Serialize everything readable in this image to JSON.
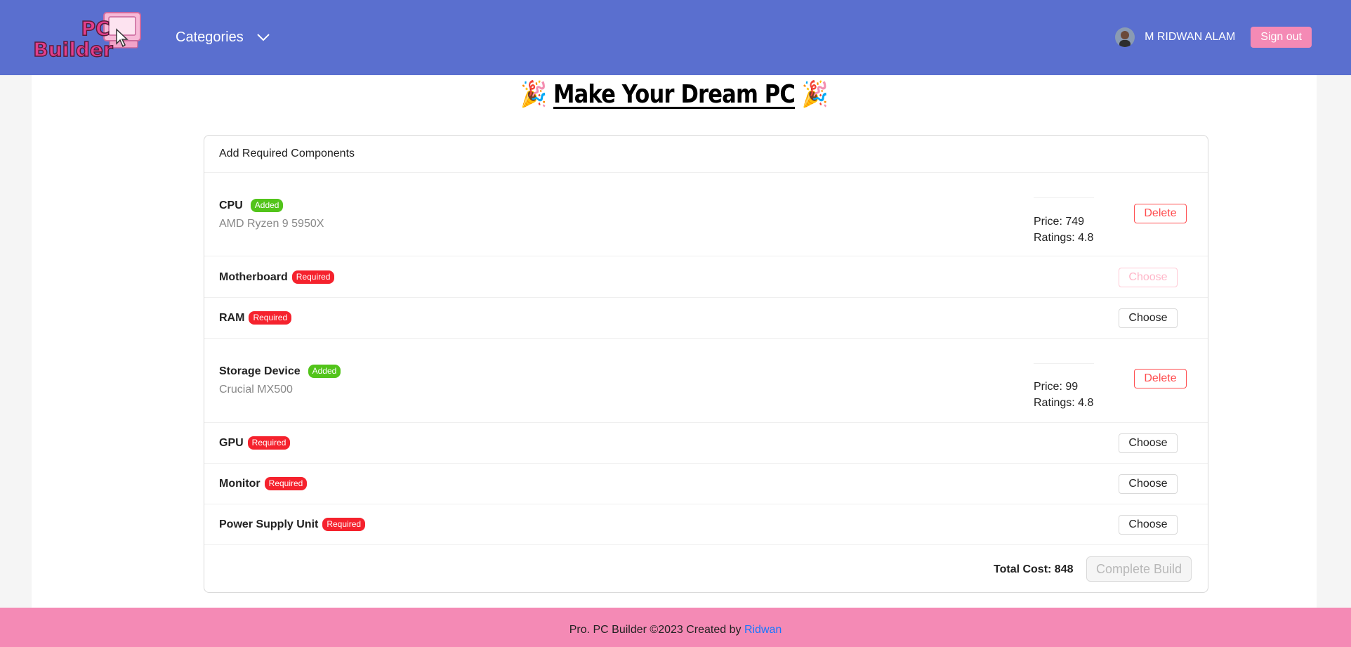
{
  "header": {
    "logo_text_line1": "PC",
    "logo_text_line2": "Builder",
    "categories_label": "Categories",
    "user_name": "M RIDWAN ALAM",
    "signout_label": "Sign out"
  },
  "page": {
    "title": "Make Your Dream PC",
    "party_emoji": "🎉"
  },
  "card": {
    "head": "Add Required Components",
    "components": [
      {
        "name": "CPU",
        "status": "Added",
        "product": "AMD Ryzen 9 5950X",
        "price": "Price: 749",
        "ratings": "Ratings: 4.8",
        "action": "Delete"
      },
      {
        "name": "Motherboard",
        "status": "Required",
        "action": "Choose",
        "action_disabled": true
      },
      {
        "name": "RAM",
        "status": "Required",
        "action": "Choose"
      },
      {
        "name": "Storage Device",
        "status": "Added",
        "product": "Crucial MX500",
        "price": "Price: 99",
        "ratings": "Ratings: 4.8",
        "action": "Delete"
      },
      {
        "name": "GPU",
        "status": "Required",
        "action": "Choose"
      },
      {
        "name": "Monitor",
        "status": "Required",
        "action": "Choose"
      },
      {
        "name": "Power Supply Unit",
        "status": "Required",
        "action": "Choose"
      }
    ],
    "total": "Total Cost: 848",
    "complete_label": "Complete Build"
  },
  "footer": {
    "text": "Pro. PC Builder ©2023 Created by ",
    "author_link": "Ridwan"
  },
  "colors": {
    "header_bg": "#5a6fcf",
    "footer_bg": "#f48ab5",
    "added_badge": "#52c41a",
    "required_badge": "#f5222d",
    "delete_red": "#ff4d4f"
  }
}
